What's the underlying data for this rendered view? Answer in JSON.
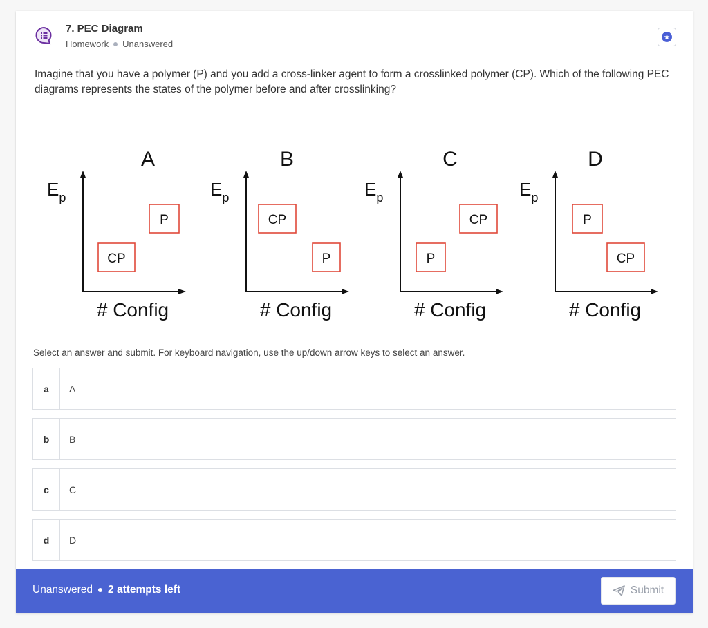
{
  "question": {
    "title": "7. PEC Diagram",
    "category": "Homework",
    "status": "Unanswered",
    "prompt": "Imagine that you have a polymer (P) and you add a cross-linker agent to form a crosslinked polymer (CP). Which of the following PEC diagrams represents the states of the polymer before and after crosslinking?"
  },
  "figure": {
    "y_label_main": "E",
    "y_label_sub": "p",
    "x_label": "# Config",
    "panels": [
      {
        "name": "A",
        "upper_box": "P",
        "lower_box": "CP"
      },
      {
        "name": "B",
        "upper_box": "CP",
        "lower_box": "P"
      },
      {
        "name": "C",
        "upper_box": "CP",
        "lower_box": "P"
      },
      {
        "name": "D",
        "upper_box": "P",
        "lower_box": "CP"
      }
    ]
  },
  "instructions": "Select an answer and submit. For keyboard navigation, use the up/down arrow keys to select an answer.",
  "options": [
    {
      "key": "a",
      "label": "A"
    },
    {
      "key": "b",
      "label": "B"
    },
    {
      "key": "c",
      "label": "C"
    },
    {
      "key": "d",
      "label": "D"
    }
  ],
  "footer": {
    "status": "Unanswered",
    "attempts": "2 attempts left",
    "submit_label": "Submit"
  },
  "colors": {
    "accent": "#4a63d2",
    "box_border": "#e0493a",
    "icon_purple": "#6b2fa0"
  }
}
